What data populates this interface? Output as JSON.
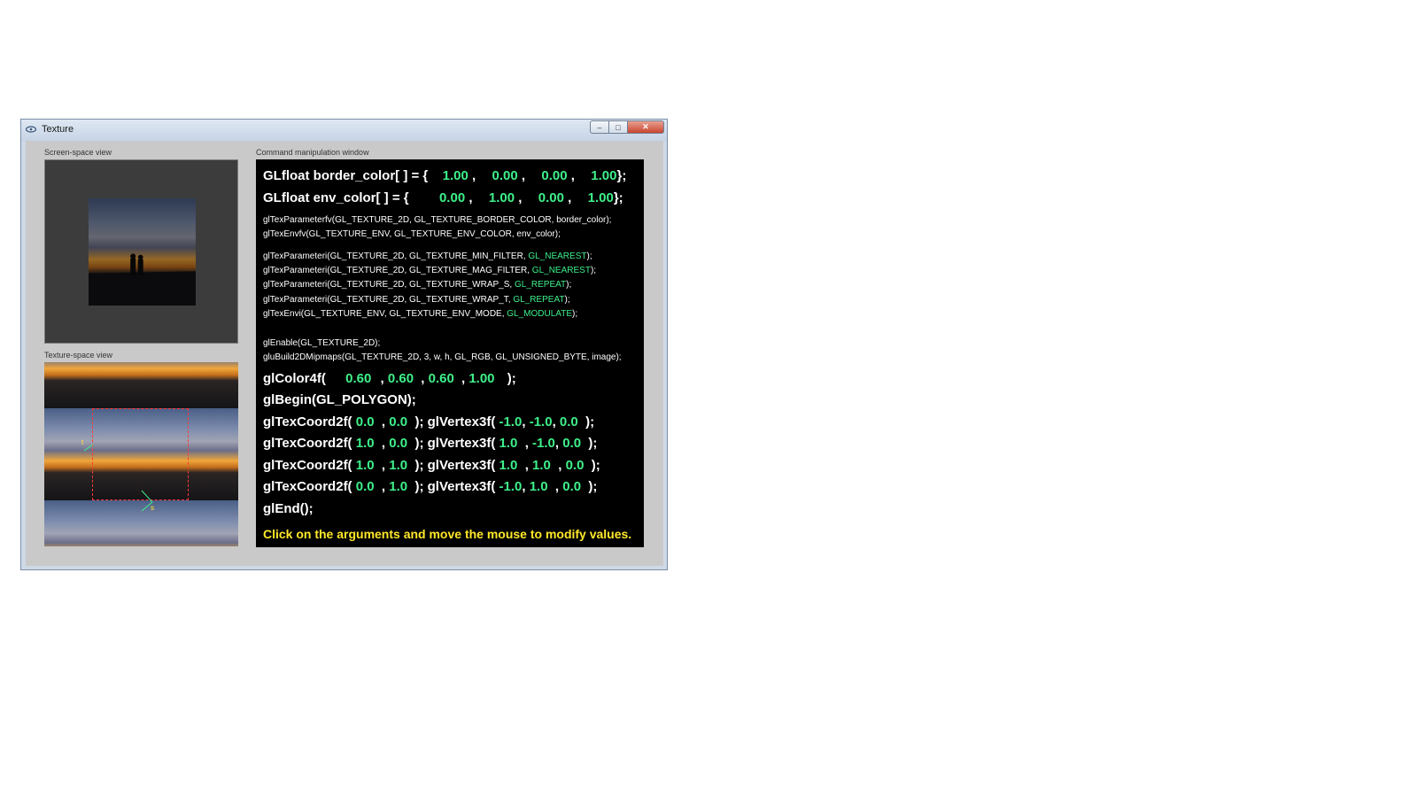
{
  "window": {
    "title": "Texture",
    "min_glyph": "‒",
    "max_glyph": "□",
    "close_glyph": "✕"
  },
  "labels": {
    "screen_view": "Screen-space view",
    "texture_view": "Texture-space view",
    "command_window": "Command manipulation window"
  },
  "texture_marks": {
    "t": "t",
    "s": "s"
  },
  "code": {
    "border_color": {
      "prefix": "GLfloat border_color[ ] = {",
      "values": [
        "1.00",
        "0.00",
        "0.00",
        "1.00"
      ],
      "suffix": "};"
    },
    "env_color": {
      "prefix": "GLfloat env_color[ ] = {",
      "values": [
        "0.00",
        "1.00",
        "0.00",
        "1.00"
      ],
      "suffix": "};"
    },
    "texparamfv": "glTexParameterfv(GL_TEXTURE_2D, GL_TEXTURE_BORDER_COLOR, border_color);",
    "texenvfv": "glTexEnvfv(GL_TEXTURE_ENV, GL_TEXTURE_ENV_COLOR, env_color);",
    "params": [
      {
        "prefix": "glTexParameteri(GL_TEXTURE_2D, GL_TEXTURE_MIN_FILTER,",
        "value": "GL_NEAREST",
        "suffix": ");"
      },
      {
        "prefix": "glTexParameteri(GL_TEXTURE_2D, GL_TEXTURE_MAG_FILTER,",
        "value": "GL_NEAREST",
        "suffix": ");"
      },
      {
        "prefix": "glTexParameteri(GL_TEXTURE_2D, GL_TEXTURE_WRAP_S,",
        "value": "GL_REPEAT",
        "suffix": ");"
      },
      {
        "prefix": "glTexParameteri(GL_TEXTURE_2D, GL_TEXTURE_WRAP_T,",
        "value": "GL_REPEAT",
        "suffix": ");"
      },
      {
        "prefix": "glTexEnvi(GL_TEXTURE_ENV, GL_TEXTURE_ENV_MODE,",
        "value": "GL_MODULATE",
        "suffix": ");"
      }
    ],
    "enable": "glEnable(GL_TEXTURE_2D);",
    "mipmaps": "gluBuild2DMipmaps(GL_TEXTURE_2D, 3, w, h, GL_RGB, GL_UNSIGNED_BYTE, image);",
    "color4f": {
      "prefix": "glColor4f(",
      "values": [
        "0.60",
        "0.60",
        "0.60",
        "1.00"
      ],
      "suffix": ");"
    },
    "begin": "glBegin(GL_POLYGON);",
    "vertices": [
      {
        "tex": [
          "0.0",
          "0.0"
        ],
        "pos": [
          "-1.0",
          "-1.0",
          "0.0"
        ]
      },
      {
        "tex": [
          "1.0",
          "0.0"
        ],
        "pos": [
          "1.0",
          "-1.0",
          "0.0"
        ]
      },
      {
        "tex": [
          "1.0",
          "1.0"
        ],
        "pos": [
          "1.0",
          "1.0",
          "0.0"
        ]
      },
      {
        "tex": [
          "0.0",
          "1.0"
        ],
        "pos": [
          "-1.0",
          "1.0",
          "0.0"
        ]
      }
    ],
    "texcoord_prefix": "glTexCoord2f(",
    "vertex_prefix": "glVertex3f(",
    "end": "glEnd();",
    "hint": "Click on the arguments and move the mouse to modify values."
  },
  "colors": {
    "value": "#3ef08a",
    "hint": "#ffe82a",
    "dash": "#ff3a3a"
  }
}
